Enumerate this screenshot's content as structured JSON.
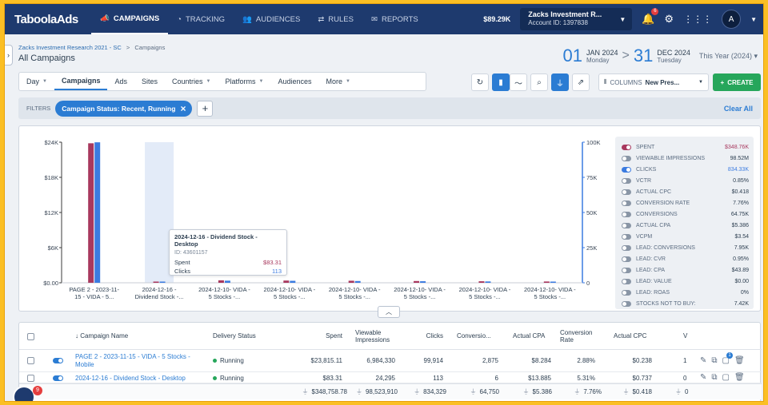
{
  "nav": {
    "logo": "TaboolaAds",
    "items": [
      {
        "label": "CAMPAIGNS",
        "icon": "megaphone-icon",
        "active": true
      },
      {
        "label": "TRACKING",
        "icon": "gauge-icon"
      },
      {
        "label": "AUDIENCES",
        "icon": "people-icon"
      },
      {
        "label": "RULES",
        "icon": "rules-icon"
      },
      {
        "label": "REPORTS",
        "icon": "envelope-icon"
      }
    ],
    "balance": "$89.29K",
    "account_name": "Zacks Investment R...",
    "account_id": "Account ID: 1397838",
    "notification_count": "6",
    "avatar_initial": "A"
  },
  "header": {
    "breadcrumb_link": "Zacks Investment Research 2021 - SC",
    "breadcrumb_sep": ">",
    "breadcrumb_current": "Campaigns",
    "title": "All Campaigns",
    "start_day": "01",
    "start_month": "JAN 2024",
    "start_weekday": "Monday",
    "end_day": "31",
    "end_month": "DEC 2024",
    "end_weekday": "Tuesday",
    "range_sep": ">",
    "period": "This Year (2024)",
    "period_caret": "▾"
  },
  "tabs": {
    "day": "Day",
    "campaigns": "Campaigns",
    "ads": "Ads",
    "sites": "Sites",
    "countries": "Countries",
    "platforms": "Platforms",
    "audiences": "Audiences",
    "more": "More"
  },
  "toolbar": {
    "columns_label": "COLUMNS",
    "columns_value": "New Pres...",
    "create_label": "CREATE",
    "create_plus": "+"
  },
  "filters": {
    "label": "FILTERS",
    "chip": "Campaign Status: Recent, Running",
    "chip_close": "×",
    "add": "+",
    "clear_all": "Clear All"
  },
  "chart_data": {
    "type": "bar",
    "categories": [
      "PAGE 2 - 2023-11-15 - VIDA - 5...",
      "2024-12-16 - Dividend Stock -...",
      "2024-12-10- VIDA - 5 Stocks -...",
      "2024-12-10- VIDA - 5 Stocks -...",
      "2024-12-10- VIDA - 5 Stocks -...",
      "2024-12-10- VIDA - 5 Stocks -...",
      "2024-12-10- VIDA - 5 Stocks -...",
      "2024-12-10- VIDA - 5 Stocks -..."
    ],
    "category_lines": [
      [
        "PAGE 2 - 2023-11-",
        "15 - VIDA - 5..."
      ],
      [
        "2024-12-16 -",
        "Dividend Stock -..."
      ],
      [
        "2024-12-10- VIDA -",
        "5 Stocks -..."
      ],
      [
        "2024-12-10- VIDA -",
        "5 Stocks -..."
      ],
      [
        "2024-12-10- VIDA -",
        "5 Stocks -..."
      ],
      [
        "2024-12-10- VIDA -",
        "5 Stocks -..."
      ],
      [
        "2024-12-10- VIDA -",
        "5 Stocks -..."
      ],
      [
        "2024-12-10- VIDA -",
        "5 Stocks -..."
      ]
    ],
    "series": [
      {
        "name": "Spent",
        "axis": "left",
        "color": "#a8385e",
        "values": [
          23815.11,
          83.31,
          420,
          380,
          350,
          300,
          260,
          220
        ]
      },
      {
        "name": "Clicks",
        "axis": "right",
        "color": "#3b7be0",
        "values": [
          99914,
          113,
          1500,
          1400,
          1250,
          1100,
          950,
          800
        ]
      }
    ],
    "left_ticks": [
      "$0.00",
      "$6K",
      "$12K",
      "$18K",
      "$24K"
    ],
    "right_ticks": [
      "0",
      "25K",
      "50K",
      "75K",
      "100K"
    ],
    "ylim_left": [
      0,
      24000
    ],
    "ylim_right": [
      0,
      100000
    ],
    "highlight_index": 1,
    "grid": false
  },
  "tooltip": {
    "title": "2024-12-16 - Dividend Stock - Desktop",
    "id": "ID: 43601157",
    "spent_label": "Spent",
    "spent_value": "$83.31",
    "clicks_label": "Clicks",
    "clicks_value": "113"
  },
  "metrics": [
    {
      "name": "SPENT",
      "value": "$348.76K",
      "on": true,
      "color": "#a8385e"
    },
    {
      "name": "VIEWABLE IMPRESSIONS",
      "value": "98.52M",
      "on": false
    },
    {
      "name": "CLICKS",
      "value": "834.33K",
      "on": true,
      "color": "#3b7be0"
    },
    {
      "name": "VCTR",
      "value": "0.85%",
      "on": false
    },
    {
      "name": "ACTUAL CPC",
      "value": "$0.418",
      "on": false
    },
    {
      "name": "CONVERSION RATE",
      "value": "7.76%",
      "on": false
    },
    {
      "name": "CONVERSIONS",
      "value": "64.75K",
      "on": false
    },
    {
      "name": "ACTUAL CPA",
      "value": "$5.386",
      "on": false
    },
    {
      "name": "VCPM",
      "value": "$3.54",
      "on": false
    },
    {
      "name": "LEAD: CONVERSIONS",
      "value": "7.95K",
      "on": false
    },
    {
      "name": "LEAD: CVR",
      "value": "0.95%",
      "on": false
    },
    {
      "name": "LEAD: CPA",
      "value": "$43.89",
      "on": false
    },
    {
      "name": "LEAD: VALUE",
      "value": "$0.00",
      "on": false
    },
    {
      "name": "LEAD: ROAS",
      "value": "0%",
      "on": false
    },
    {
      "name": "STOCKS NOT TO BUY:",
      "value": "7.42K",
      "on": false
    }
  ],
  "table": {
    "headers": {
      "name": "↓ Campaign Name",
      "status": "Delivery Status",
      "spent": "Spent",
      "impr": "Viewable Impressions",
      "clicks": "Clicks",
      "conv": "Conversio...",
      "cpa": "Actual CPA",
      "cvr": "Conversion Rate",
      "cpc": "Actual CPC",
      "more": "V"
    },
    "rows": [
      {
        "name": "PAGE 2 - 2023-11-15 - VIDA - 5 Stocks - Mobile",
        "status": "Running",
        "spent": "$23,815.11",
        "impr": "6,984,330",
        "clicks": "99,914",
        "conv": "2,875",
        "cpa": "$8.284",
        "cvr": "2.88%",
        "cpc": "$0.238",
        "extra": "1"
      },
      {
        "name": "2024-12-16 - Dividend Stock - Desktop",
        "status": "Running",
        "spent": "$83.31",
        "impr": "24,295",
        "clicks": "113",
        "conv": "6",
        "cpa": "$13.885",
        "cvr": "5.31%",
        "cpc": "$0.737",
        "extra": "0"
      }
    ],
    "totals": {
      "spent": "$348,758.78",
      "impr": "98,523,910",
      "clicks": "834,329",
      "conv": "64,750",
      "cpa": "$5.386",
      "cvr": "7.76%",
      "cpc": "$0.418",
      "extra": "0"
    },
    "row1_badge": "1"
  },
  "chat": {
    "badge": "9"
  }
}
